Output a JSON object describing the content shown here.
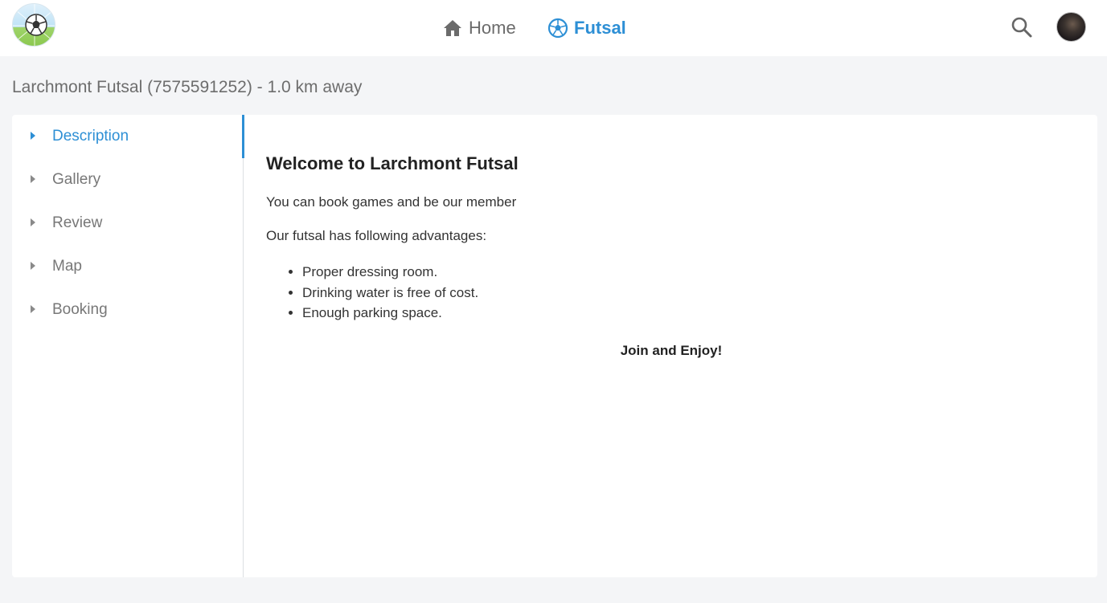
{
  "header": {
    "logo_icon": "soccer-ball-net-logo",
    "nav": [
      {
        "label": "Home",
        "icon": "home-icon",
        "active": false
      },
      {
        "label": "Futsal",
        "icon": "soccer-ball-icon",
        "active": true
      }
    ],
    "search_icon": "search-icon",
    "avatar_icon": "user-avatar"
  },
  "page": {
    "title": "Larchmont Futsal (7575591252) - 1.0 km away"
  },
  "sidebar": {
    "items": [
      {
        "label": "Description",
        "active": true
      },
      {
        "label": "Gallery",
        "active": false
      },
      {
        "label": "Review",
        "active": false
      },
      {
        "label": "Map",
        "active": false
      },
      {
        "label": "Booking",
        "active": false
      }
    ]
  },
  "description": {
    "heading": "Welcome to Larchmont Futsal",
    "intro": "You can book games and be our member",
    "advantages_intro": "Our futsal has following advantages:",
    "advantages": [
      "Proper dressing room.",
      "Drinking water is free of cost.",
      "Enough parking space."
    ],
    "closing": "Join and Enjoy!"
  },
  "colors": {
    "accent": "#2d8fd5",
    "background": "#f4f5f7",
    "muted_text": "#777777"
  }
}
